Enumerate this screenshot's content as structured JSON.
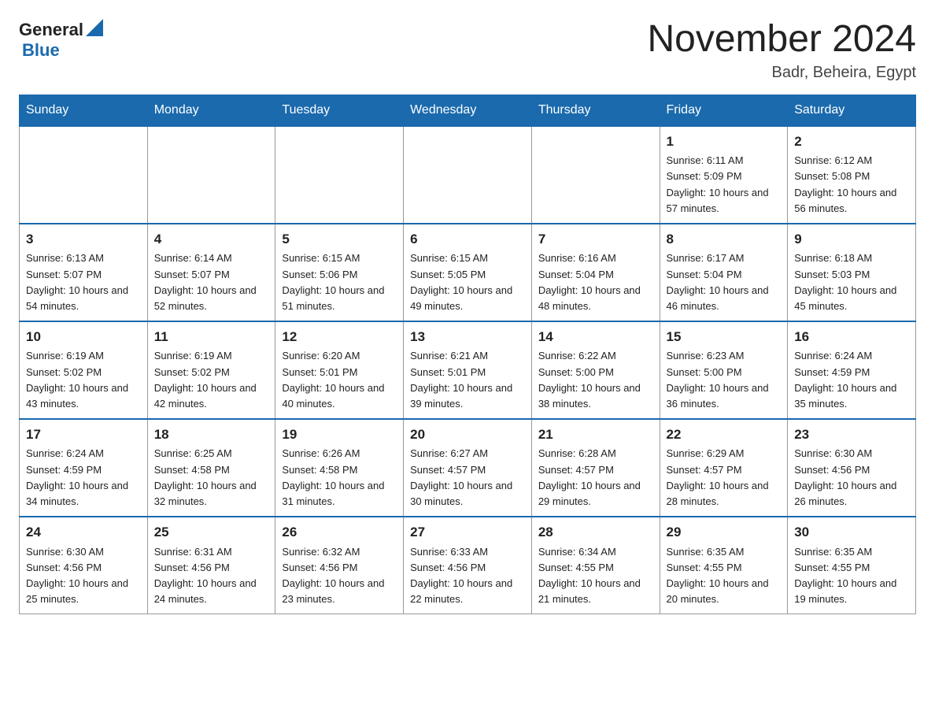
{
  "header": {
    "logo": {
      "general": "General",
      "blue": "Blue"
    },
    "title": "November 2024",
    "location": "Badr, Beheira, Egypt"
  },
  "days_of_week": [
    "Sunday",
    "Monday",
    "Tuesday",
    "Wednesday",
    "Thursday",
    "Friday",
    "Saturday"
  ],
  "weeks": [
    [
      {
        "day": "",
        "info": ""
      },
      {
        "day": "",
        "info": ""
      },
      {
        "day": "",
        "info": ""
      },
      {
        "day": "",
        "info": ""
      },
      {
        "day": "",
        "info": ""
      },
      {
        "day": "1",
        "info": "Sunrise: 6:11 AM\nSunset: 5:09 PM\nDaylight: 10 hours and 57 minutes."
      },
      {
        "day": "2",
        "info": "Sunrise: 6:12 AM\nSunset: 5:08 PM\nDaylight: 10 hours and 56 minutes."
      }
    ],
    [
      {
        "day": "3",
        "info": "Sunrise: 6:13 AM\nSunset: 5:07 PM\nDaylight: 10 hours and 54 minutes."
      },
      {
        "day": "4",
        "info": "Sunrise: 6:14 AM\nSunset: 5:07 PM\nDaylight: 10 hours and 52 minutes."
      },
      {
        "day": "5",
        "info": "Sunrise: 6:15 AM\nSunset: 5:06 PM\nDaylight: 10 hours and 51 minutes."
      },
      {
        "day": "6",
        "info": "Sunrise: 6:15 AM\nSunset: 5:05 PM\nDaylight: 10 hours and 49 minutes."
      },
      {
        "day": "7",
        "info": "Sunrise: 6:16 AM\nSunset: 5:04 PM\nDaylight: 10 hours and 48 minutes."
      },
      {
        "day": "8",
        "info": "Sunrise: 6:17 AM\nSunset: 5:04 PM\nDaylight: 10 hours and 46 minutes."
      },
      {
        "day": "9",
        "info": "Sunrise: 6:18 AM\nSunset: 5:03 PM\nDaylight: 10 hours and 45 minutes."
      }
    ],
    [
      {
        "day": "10",
        "info": "Sunrise: 6:19 AM\nSunset: 5:02 PM\nDaylight: 10 hours and 43 minutes."
      },
      {
        "day": "11",
        "info": "Sunrise: 6:19 AM\nSunset: 5:02 PM\nDaylight: 10 hours and 42 minutes."
      },
      {
        "day": "12",
        "info": "Sunrise: 6:20 AM\nSunset: 5:01 PM\nDaylight: 10 hours and 40 minutes."
      },
      {
        "day": "13",
        "info": "Sunrise: 6:21 AM\nSunset: 5:01 PM\nDaylight: 10 hours and 39 minutes."
      },
      {
        "day": "14",
        "info": "Sunrise: 6:22 AM\nSunset: 5:00 PM\nDaylight: 10 hours and 38 minutes."
      },
      {
        "day": "15",
        "info": "Sunrise: 6:23 AM\nSunset: 5:00 PM\nDaylight: 10 hours and 36 minutes."
      },
      {
        "day": "16",
        "info": "Sunrise: 6:24 AM\nSunset: 4:59 PM\nDaylight: 10 hours and 35 minutes."
      }
    ],
    [
      {
        "day": "17",
        "info": "Sunrise: 6:24 AM\nSunset: 4:59 PM\nDaylight: 10 hours and 34 minutes."
      },
      {
        "day": "18",
        "info": "Sunrise: 6:25 AM\nSunset: 4:58 PM\nDaylight: 10 hours and 32 minutes."
      },
      {
        "day": "19",
        "info": "Sunrise: 6:26 AM\nSunset: 4:58 PM\nDaylight: 10 hours and 31 minutes."
      },
      {
        "day": "20",
        "info": "Sunrise: 6:27 AM\nSunset: 4:57 PM\nDaylight: 10 hours and 30 minutes."
      },
      {
        "day": "21",
        "info": "Sunrise: 6:28 AM\nSunset: 4:57 PM\nDaylight: 10 hours and 29 minutes."
      },
      {
        "day": "22",
        "info": "Sunrise: 6:29 AM\nSunset: 4:57 PM\nDaylight: 10 hours and 28 minutes."
      },
      {
        "day": "23",
        "info": "Sunrise: 6:30 AM\nSunset: 4:56 PM\nDaylight: 10 hours and 26 minutes."
      }
    ],
    [
      {
        "day": "24",
        "info": "Sunrise: 6:30 AM\nSunset: 4:56 PM\nDaylight: 10 hours and 25 minutes."
      },
      {
        "day": "25",
        "info": "Sunrise: 6:31 AM\nSunset: 4:56 PM\nDaylight: 10 hours and 24 minutes."
      },
      {
        "day": "26",
        "info": "Sunrise: 6:32 AM\nSunset: 4:56 PM\nDaylight: 10 hours and 23 minutes."
      },
      {
        "day": "27",
        "info": "Sunrise: 6:33 AM\nSunset: 4:56 PM\nDaylight: 10 hours and 22 minutes."
      },
      {
        "day": "28",
        "info": "Sunrise: 6:34 AM\nSunset: 4:55 PM\nDaylight: 10 hours and 21 minutes."
      },
      {
        "day": "29",
        "info": "Sunrise: 6:35 AM\nSunset: 4:55 PM\nDaylight: 10 hours and 20 minutes."
      },
      {
        "day": "30",
        "info": "Sunrise: 6:35 AM\nSunset: 4:55 PM\nDaylight: 10 hours and 19 minutes."
      }
    ]
  ]
}
